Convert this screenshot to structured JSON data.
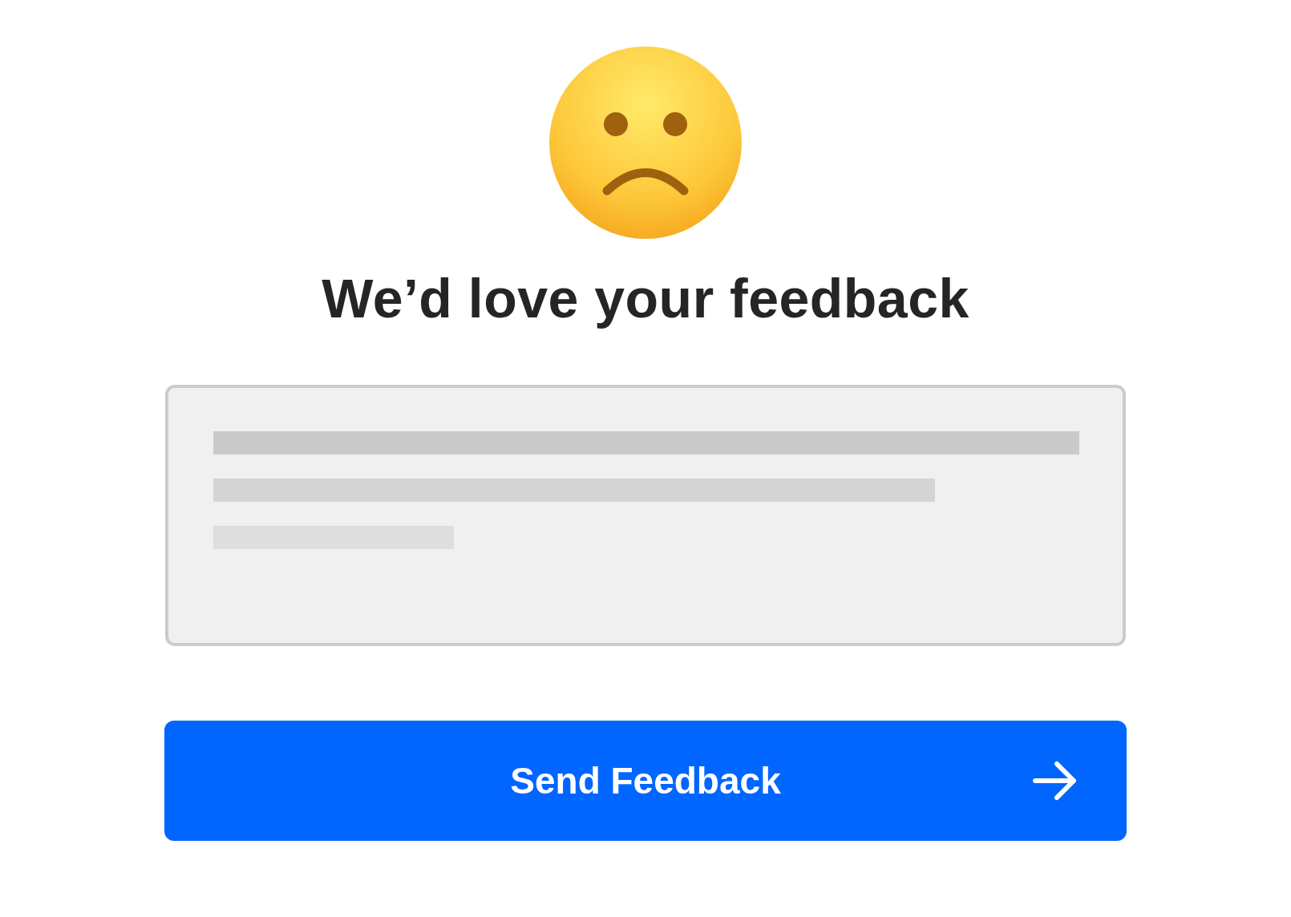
{
  "title": "We’d love your feedback",
  "button": {
    "label": "Send Feedback"
  }
}
